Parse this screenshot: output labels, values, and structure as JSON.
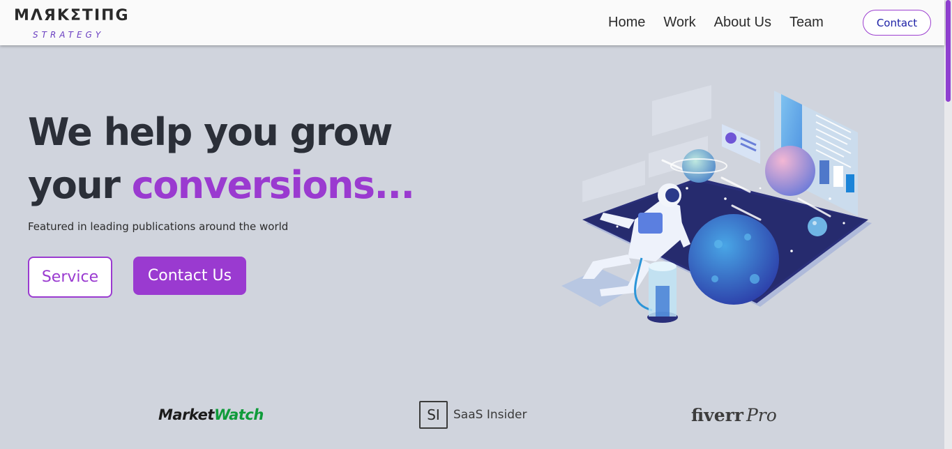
{
  "nav": {
    "logo_main": "ΜΛЯΚΣΤΙΠG",
    "logo_sub": "STRATEGY",
    "links": [
      "Home",
      "Work",
      "About Us",
      "Team"
    ],
    "contact_label": "Contact"
  },
  "hero": {
    "title_line1": "We help you grow",
    "title_line2_prefix": "your ",
    "title_line2_accent": "conversions...",
    "subtitle": "Featured in leading publications around the world",
    "service_button": "Service",
    "contact_button": "Contact Us"
  },
  "publications": {
    "marketwatch_part1": "Market",
    "marketwatch_part2": "Watch",
    "saas_box": "SI",
    "saas_text": "SaaS Insider",
    "fiverr": "fiverr",
    "fiverr_pro": "Pro"
  },
  "colors": {
    "accent": "#9a3ad0",
    "background": "#d0d4dd",
    "heading": "#2b2f38",
    "nav_contact_text": "#1d21a6"
  },
  "icons": [
    "astronaut-illustration",
    "marketwatch-logo",
    "saas-insider-logo",
    "fiverr-pro-logo"
  ]
}
